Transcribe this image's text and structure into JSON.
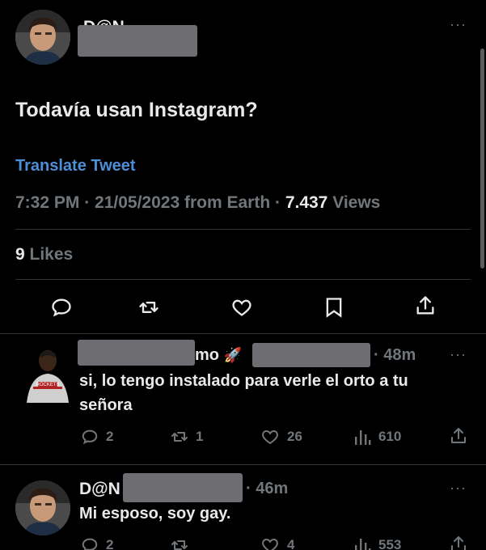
{
  "main_tweet": {
    "display_name": "D@N",
    "text": "Todavía usan Instagram?",
    "translate_label": "Translate Tweet",
    "meta_time": "7:32 PM · 21/05/2023 from Earth · ",
    "views_count": "7.437",
    "views_label": " Views",
    "likes_count": "9",
    "likes_label": " Likes",
    "more_label": "···"
  },
  "replies": [
    {
      "display_name_partial": "mo",
      "emoji": "🚀",
      "time": "· 48m",
      "text_line1": "si, lo tengo instalado para verle el orto a tu",
      "text_line2": "señora",
      "replies": "2",
      "retweets": "1",
      "likes": "26",
      "views": "610",
      "more_label": "···"
    },
    {
      "display_name": "D@N",
      "time": "· 46m",
      "text": "Mi esposo, soy gay.",
      "replies": "2",
      "likes": "4",
      "views": "553",
      "more_label": "···"
    }
  ],
  "colors": {
    "background": "#000000",
    "text": "#e7e9ea",
    "muted": "#71767b",
    "link": "#1d9bf0",
    "divider": "#2f3336"
  }
}
